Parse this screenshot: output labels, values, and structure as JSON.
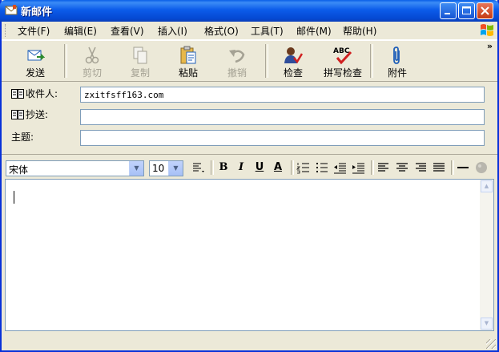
{
  "window": {
    "title": "新邮件"
  },
  "menu": [
    "文件(F)",
    "编辑(E)",
    "查看(V)",
    "插入(I)",
    "格式(O)",
    "工具(T)",
    "邮件(M)",
    "帮助(H)"
  ],
  "toolbar": {
    "send": "发送",
    "cut": "剪切",
    "copy": "复制",
    "paste": "粘贴",
    "undo": "撤销",
    "check": "检查",
    "spell": "拼写检查",
    "attach": "附件",
    "more": "»"
  },
  "headers": {
    "to_label": "收件人:",
    "to_value": "zxitfsff163.com",
    "cc_label": "抄送:",
    "cc_value": "",
    "subject_label": "主题:",
    "subject_value": ""
  },
  "format": {
    "font": "宋体",
    "size": "10",
    "bold": "B",
    "italic": "I",
    "underline": "U",
    "font_color": "A"
  },
  "body": {
    "text": ""
  }
}
